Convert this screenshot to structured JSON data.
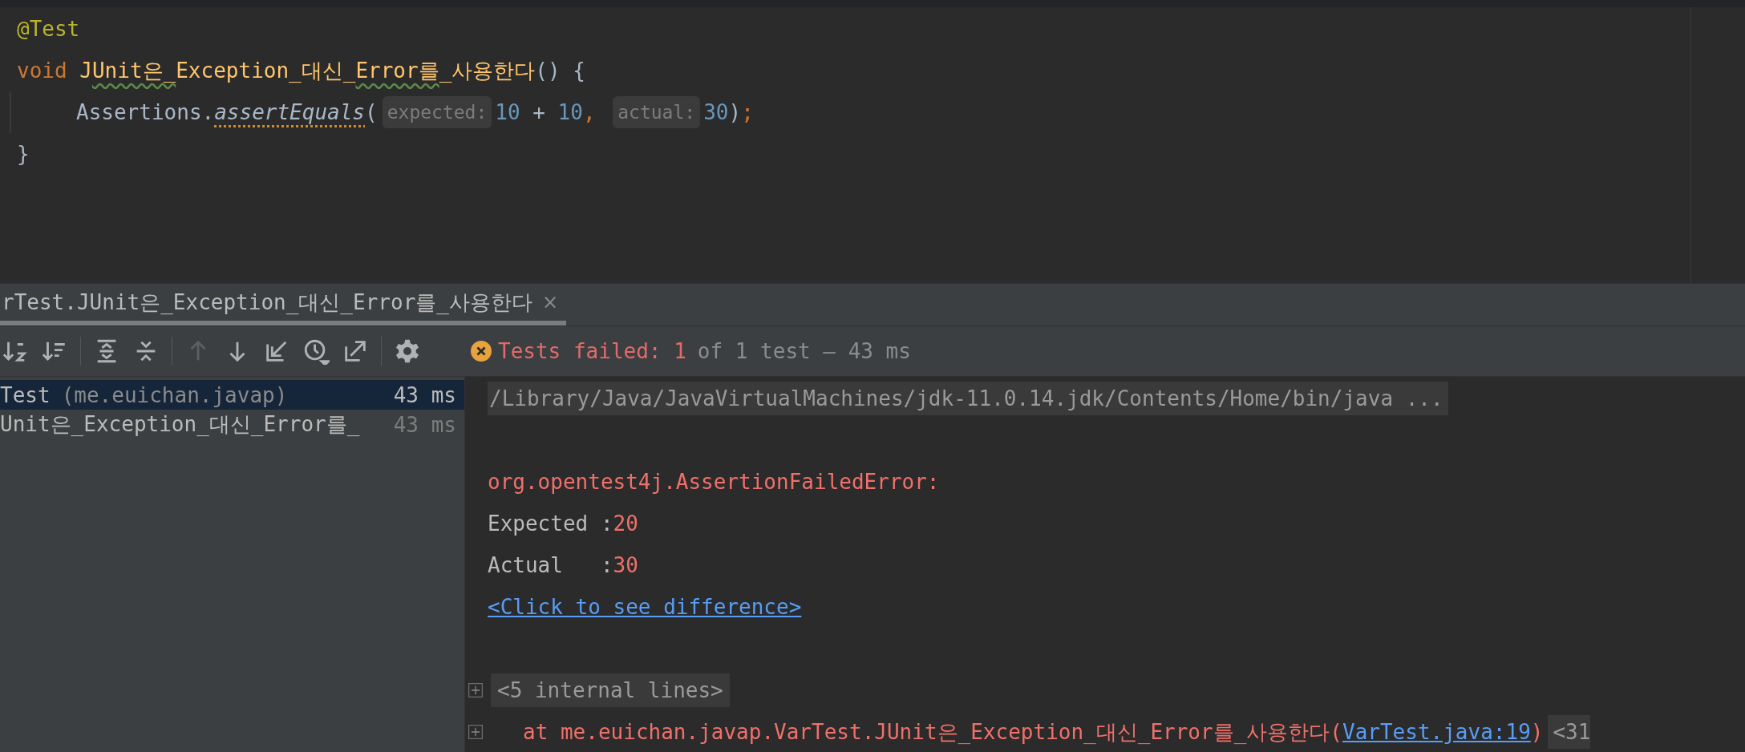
{
  "editor": {
    "lines": [
      {
        "tokens": [
          {
            "text": "@Test",
            "kind": "annotation"
          }
        ]
      },
      {
        "tokens": [
          {
            "text": "void ",
            "kind": "keyword"
          },
          {
            "text": "J",
            "kind": "declaration"
          },
          {
            "text": "Unit은_",
            "kind": "flagged-declaration"
          },
          {
            "text": "Exception_대신_",
            "kind": "declaration"
          },
          {
            "text": "Error를",
            "kind": "flagged-declaration"
          },
          {
            "text": "_사용한다",
            "kind": "declaration"
          },
          {
            "text": "() {",
            "kind": "plain"
          }
        ]
      },
      {
        "indent": true,
        "tokens": [
          {
            "text": "Assertions.",
            "kind": "plain"
          },
          {
            "text": "assertEquals",
            "kind": "flagged-static-call"
          },
          {
            "text": "(",
            "kind": "plain"
          },
          {
            "text": "expected:",
            "kind": "hint"
          },
          {
            "text": "10",
            "kind": "number"
          },
          {
            "text": " + ",
            "kind": "plain"
          },
          {
            "text": "10",
            "kind": "number"
          },
          {
            "text": ", ",
            "kind": "keyword"
          },
          {
            "text": "actual:",
            "kind": "hint"
          },
          {
            "text": "30",
            "kind": "number"
          },
          {
            "text": ")",
            "kind": "plain"
          },
          {
            "text": ";",
            "kind": "keyword"
          }
        ]
      },
      {
        "tokens": [
          {
            "text": "}",
            "kind": "plain"
          }
        ]
      }
    ]
  },
  "run_tab": {
    "label": "rTest.JUnit은_Exception_대신_Error를_사용한다",
    "close": "×",
    "selected": true
  },
  "toolbar": [
    {
      "kind": "sort-alpha",
      "disabled": false
    },
    {
      "kind": "sort-duration",
      "disabled": false
    },
    {
      "kind": "separator"
    },
    {
      "kind": "expand-all",
      "disabled": false
    },
    {
      "kind": "collapse-all",
      "disabled": false
    },
    {
      "kind": "separator"
    },
    {
      "kind": "previous",
      "disabled": true
    },
    {
      "kind": "next",
      "disabled": false
    },
    {
      "kind": "import",
      "disabled": false
    },
    {
      "kind": "history",
      "disabled": false
    },
    {
      "kind": "export",
      "disabled": false
    },
    {
      "kind": "separator"
    },
    {
      "kind": "settings",
      "disabled": false
    }
  ],
  "status": {
    "failed": "Tests failed: 1",
    "rest": "of 1 test – 43 ms"
  },
  "tree": [
    {
      "name": "Test",
      "package": "(me.euichan.javap)",
      "time": "43 ms",
      "selected": true
    },
    {
      "name": "Unit은_Exception_대신_Error를_",
      "time": "43 ms",
      "selected": false
    }
  ],
  "console": [
    {
      "kind": "command",
      "text": "/Library/Java/JavaVirtualMachines/jdk-11.0.14.jdk/Contents/Home/bin/java ..."
    },
    {
      "kind": "blank"
    },
    {
      "kind": "error",
      "text": "org.opentest4j.AssertionFailedError:"
    },
    {
      "kind": "value",
      "label": "Expected :",
      "value": "20"
    },
    {
      "kind": "value",
      "label": "Actual   :",
      "value": "30"
    },
    {
      "kind": "link",
      "text": "<Click to see difference>"
    },
    {
      "kind": "blank"
    },
    {
      "kind": "fold",
      "text": "<5 internal lines>"
    },
    {
      "kind": "stack",
      "text": "at me.euichan.javap.VarTest.JUnit은_Exception_대신_Error를_사용한다(",
      "link": "VarTest.java:19",
      "close": ")",
      "more": "<31"
    }
  ]
}
